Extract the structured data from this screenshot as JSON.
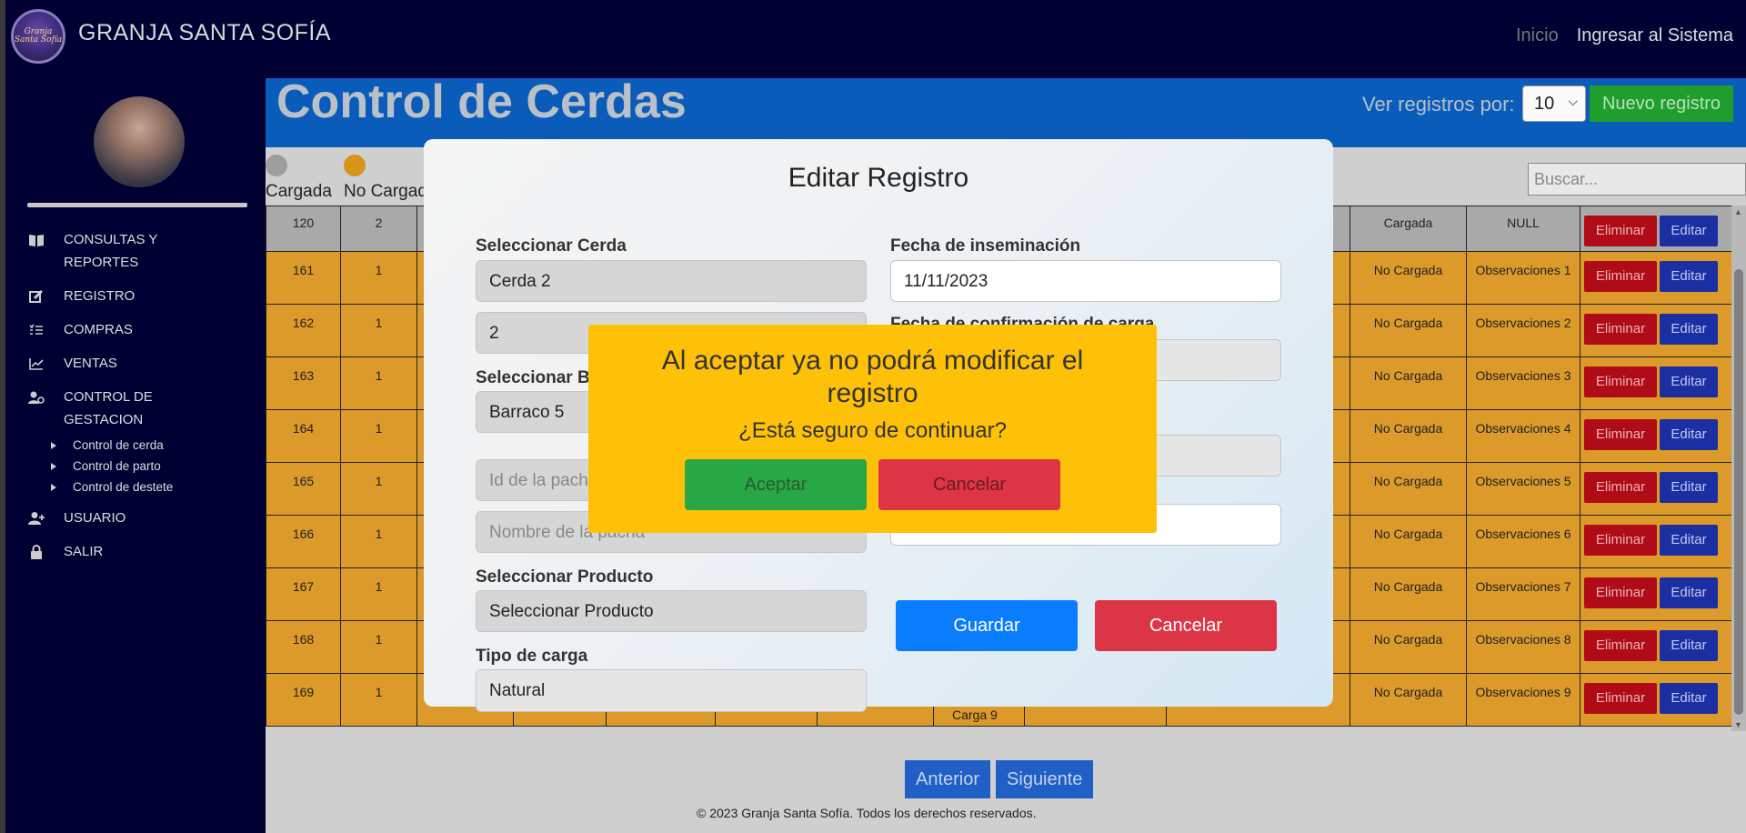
{
  "navbar": {
    "logo_text": "Granja Santa Sofía",
    "brand": "GRANJA SANTA SOFÍA",
    "links": {
      "inicio": "Inicio",
      "login": "Ingresar al Sistema"
    }
  },
  "sidebar": {
    "items": [
      {
        "label": "CONSULTAS Y REPORTES",
        "icon": "book-icon"
      },
      {
        "label": "REGISTRO",
        "icon": "edit-icon"
      },
      {
        "label": "COMPRAS",
        "icon": "list-icon"
      },
      {
        "label": "VENTAS",
        "icon": "chart-line-icon"
      },
      {
        "label": "CONTROL DE GESTACION",
        "icon": "gear-user-icon"
      }
    ],
    "subitems": [
      "Control de cerda",
      "Control de parto",
      "Control de destete"
    ],
    "items_bottom": [
      {
        "label": "USUARIO",
        "icon": "user-add-icon"
      },
      {
        "label": "SALIR",
        "icon": "lock-icon"
      }
    ]
  },
  "main": {
    "title": "Control de Cerdas",
    "ver_label": "Ver registros por:",
    "ver_value": "10",
    "nuevo_label": "Nuevo registro",
    "legend": {
      "cargada": "Cargada",
      "no_cargada": "No Cargada"
    },
    "search_placeholder": "Buscar...",
    "delete_label": "Eliminar",
    "edit_label": "Editar",
    "rows": [
      {
        "id": "120",
        "n": "2",
        "estado": "Cargada",
        "obs": "NULL",
        "kind": "grey"
      },
      {
        "id": "161",
        "n": "1",
        "estado": "No Cargada",
        "obs": "Observaciones 1",
        "kind": "orange"
      },
      {
        "id": "162",
        "n": "1",
        "estado": "No Cargada",
        "obs": "Observaciones 2",
        "kind": "orange"
      },
      {
        "id": "163",
        "n": "1",
        "estado": "No Cargada",
        "obs": "Observaciones 3",
        "kind": "orange"
      },
      {
        "id": "164",
        "n": "1",
        "estado": "No Cargada",
        "obs": "Observaciones 4",
        "kind": "orange"
      },
      {
        "id": "165",
        "n": "1",
        "estado": "No Cargada",
        "obs": "Observaciones 5",
        "kind": "orange"
      },
      {
        "id": "166",
        "n": "1",
        "estado": "No Cargada",
        "obs": "Observaciones 6",
        "kind": "orange"
      },
      {
        "id": "167",
        "n": "1",
        "estado": "No Cargada",
        "obs": "Observaciones 7",
        "kind": "orange"
      },
      {
        "id": "168",
        "n": "1",
        "estado": "No Cargada",
        "obs": "Observaciones 8",
        "kind": "orange"
      },
      {
        "id": "169",
        "n": "1",
        "estado": "No Cargada",
        "obs": "Observaciones 9",
        "kind": "orange",
        "extra": "Carga 9"
      }
    ],
    "pager": {
      "prev": "Anterior",
      "next": "Siguiente"
    },
    "footer": "© 2023 Granja Santa Sofía. Todos los derechos reservados."
  },
  "modal": {
    "title": "Editar Registro",
    "seleccionar_cerda_label": "Seleccionar Cerda",
    "cerda_value": "Cerda 2",
    "cerda_id_value": "2",
    "seleccionar_barraco_label": "Seleccionar B",
    "barraco_value": "Barraco 5",
    "id_pacha_placeholder": "Id de la pacha",
    "nombre_pacha_placeholder": "Nombre de la pacha",
    "seleccionar_producto_label": "Seleccionar Producto",
    "producto_value": "Seleccionar Producto",
    "tipo_carga_label": "Tipo de carga",
    "tipo_carga_value": "Natural",
    "fecha_inseminacion_label": "Fecha de inseminación",
    "fecha_inseminacion_value": "11/11/2023",
    "fecha_confirmacion_label": "Fecha de confirmación de carga",
    "guardar_label": "Guardar",
    "cancelar_label": "Cancelar"
  },
  "confirm": {
    "message": "Al aceptar ya no podrá modificar el registro",
    "question": "¿Está seguro de continuar?",
    "aceptar_label": "Aceptar",
    "cancelar_label": "Cancelar"
  },
  "colors": {
    "navbar": "#000033",
    "header_band": "#0a5cba",
    "row_grey": "#a9a9a9",
    "row_orange": "#dc9a2a",
    "confirm_bg": "#ffc107"
  }
}
